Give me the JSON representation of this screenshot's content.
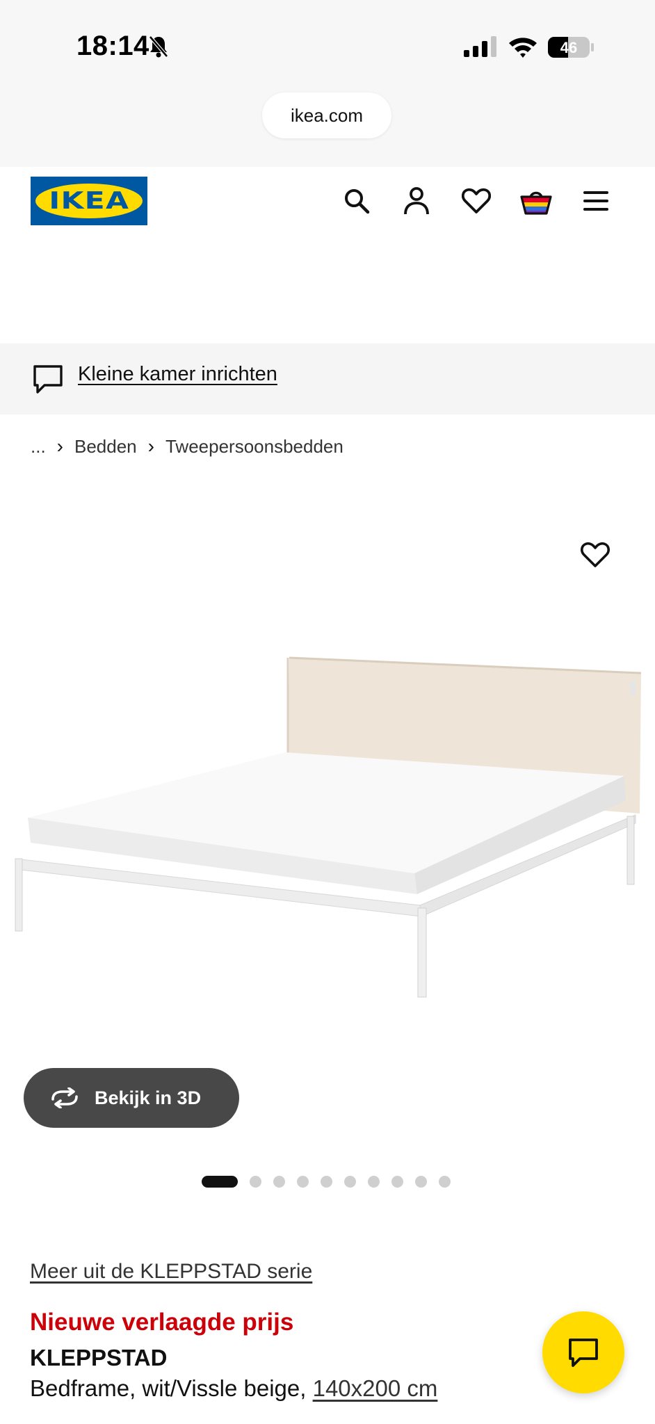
{
  "status_bar": {
    "time": "18:14",
    "battery": "46",
    "icons": [
      "bell-slash-icon",
      "cellular-signal-icon",
      "wifi-icon",
      "battery-icon"
    ]
  },
  "browser": {
    "url": "ikea.com"
  },
  "header": {
    "logo_text": "IKEA",
    "icons": [
      "search-icon",
      "account-icon",
      "heart-icon",
      "shopping-bag-icon",
      "menu-icon"
    ]
  },
  "banner": {
    "link": "Kleine kamer inrichten",
    "icon": "chat-bubble-icon"
  },
  "breadcrumb": {
    "items": [
      "...",
      "Bedden",
      "Tweepersoonsbedden"
    ]
  },
  "gallery": {
    "view_3d_label": "Bekijk in 3D",
    "image_count": 10,
    "active_index": 0
  },
  "product": {
    "series_link": "Meer uit de KLEPPSTAD serie",
    "price_note": "Nieuwe verlaagde prijs",
    "name": "KLEPPSTAD",
    "description": "Bedframe, wit/Vissle beige, ",
    "size": "140x200 cm"
  },
  "colors": {
    "ikea_blue": "#0058a3",
    "ikea_yellow": "#ffdb00",
    "price_red": "#cc0008"
  }
}
